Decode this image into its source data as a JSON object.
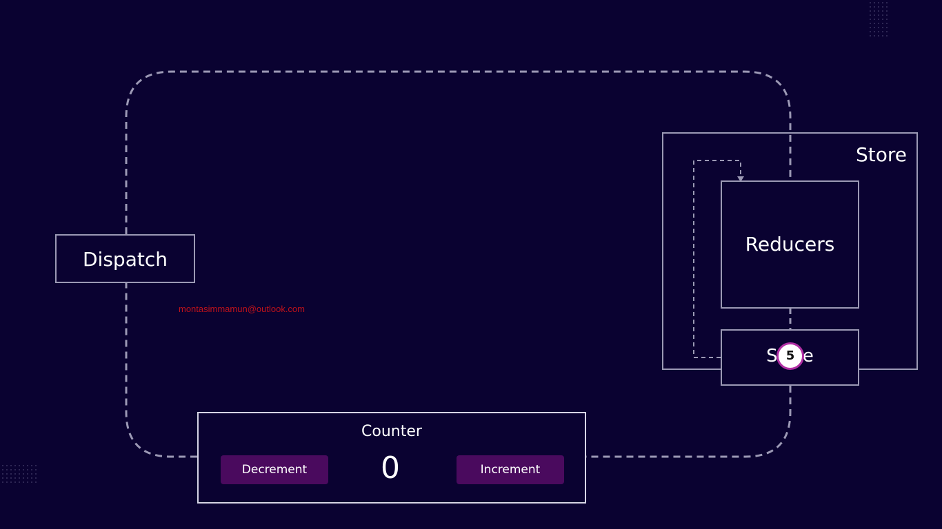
{
  "diagram": {
    "dispatch_label": "Dispatch",
    "store_label": "Store",
    "reducers_label": "Reducers",
    "state_label": "State",
    "step_badge": "5",
    "counter": {
      "title": "Counter",
      "value": "0",
      "decrement_label": "Decrement",
      "increment_label": "Increment"
    },
    "watermark": "montasimmamun@outlook.com"
  },
  "colors": {
    "background": "#0a0231",
    "line": "#9c99b5",
    "button": "#4a0a5e",
    "badge_ring": "#b02fa4",
    "watermark": "#c0121a"
  },
  "icons": [
    "arrow-head-icon"
  ]
}
